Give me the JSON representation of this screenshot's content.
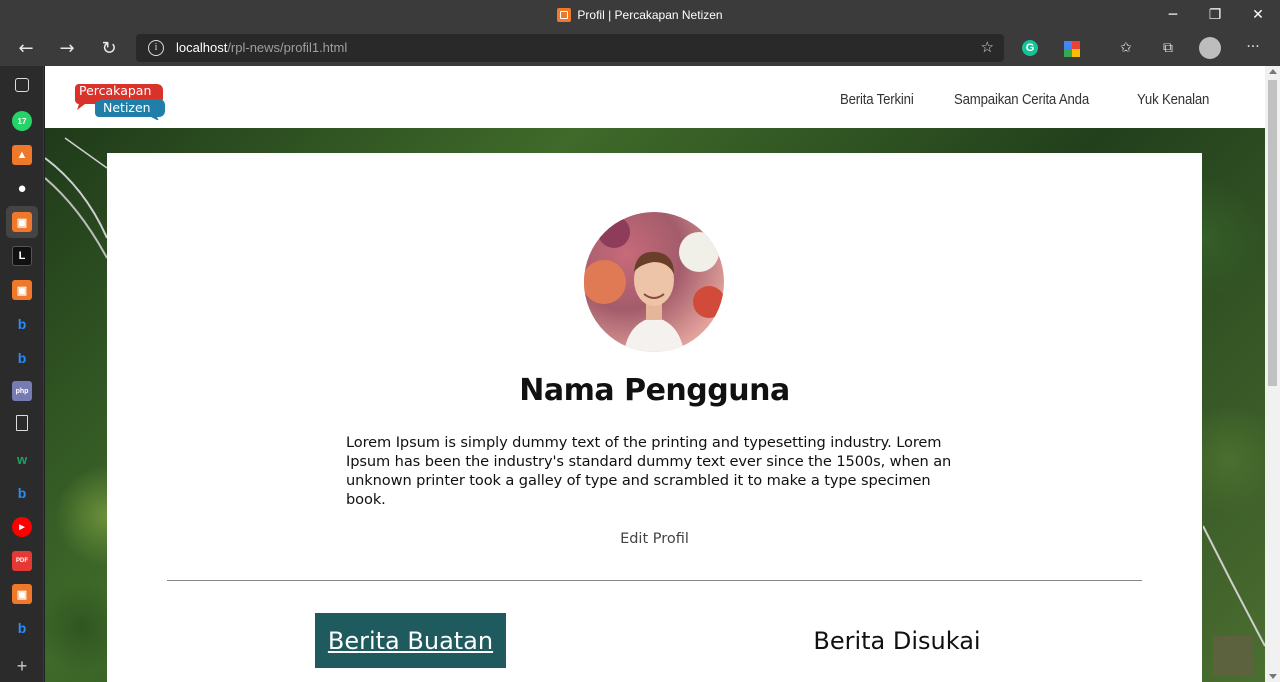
{
  "browser": {
    "window_title": "Profil | Percakapan Netizen",
    "url_host": "localhost",
    "url_path": "/rpl-news/profil1.html",
    "sidebar_badge": "17"
  },
  "site": {
    "logo_line1": "Percakapan",
    "logo_line2": "Netizen",
    "nav": [
      {
        "label": "Berita Terkini"
      },
      {
        "label": "Sampaikan Cerita Anda"
      },
      {
        "label": "Yuk Kenalan"
      }
    ]
  },
  "profile": {
    "name": "Nama Pengguna",
    "bio": "Lorem Ipsum is simply dummy text of the printing and typesetting industry. Lorem Ipsum has been the industry's standard dummy text ever since the 1500s, when an unknown printer took a galley of type and scrambled it to make a type specimen book.",
    "edit_label": "Edit Profil"
  },
  "tabs": {
    "made": "Berita Buatan",
    "liked": "Berita Disukai"
  },
  "colors": {
    "tab_active_bg": "#1e5a5e",
    "logo_red": "#d9322a",
    "logo_teal": "#1f7fa8"
  }
}
